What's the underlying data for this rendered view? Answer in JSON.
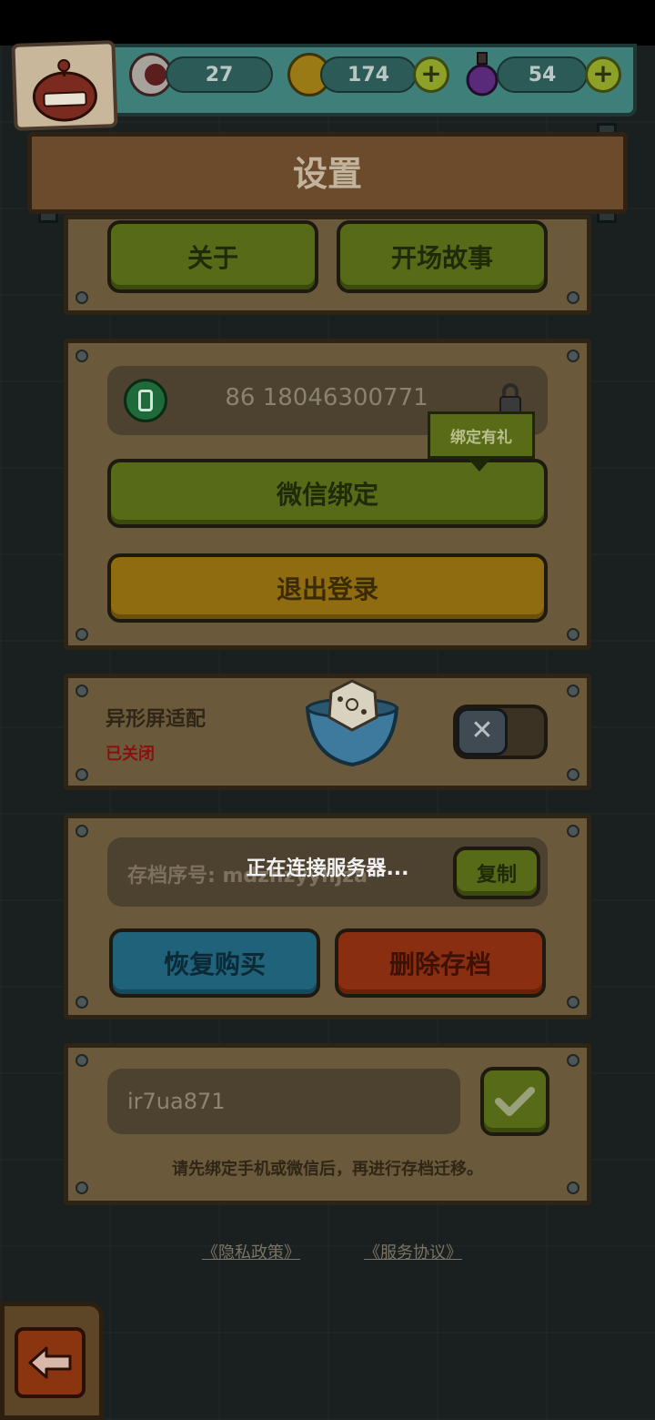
{
  "resources": {
    "eyes": "27",
    "coins": "174",
    "potions": "54"
  },
  "title": "设置",
  "top_buttons": {
    "about": "关于",
    "opening_story": "开场故事"
  },
  "account": {
    "phone": "86 18046300771",
    "tooltip": "绑定有礼",
    "wechat_bind": "微信绑定",
    "logout": "退出登录"
  },
  "notch_adapt": {
    "label": "异形屏适配",
    "status": "已关闭",
    "status_color": "#8a1010"
  },
  "save": {
    "id_label": "存档序号: mdzhzyyhjza",
    "copy": "复制",
    "restore_purchase": "恢复购买",
    "delete_save": "删除存档"
  },
  "migration": {
    "code_value": "ir7ua871",
    "hint": "请先绑定手机或微信后，再进行存档迁移。"
  },
  "links": {
    "privacy": "《隐私政策》",
    "service": "《服务协议》"
  },
  "loading": {
    "text": "正在连接服务器..."
  },
  "icons": {
    "eye": "eyeball-icon",
    "coin": "coin-icon",
    "potion": "potion-icon",
    "phone": "phone-icon",
    "lock": "lock-icon",
    "toggle": "x-icon",
    "confirm": "check-icon",
    "back": "back-arrow-icon",
    "loading": "dice-bowl-icon"
  }
}
